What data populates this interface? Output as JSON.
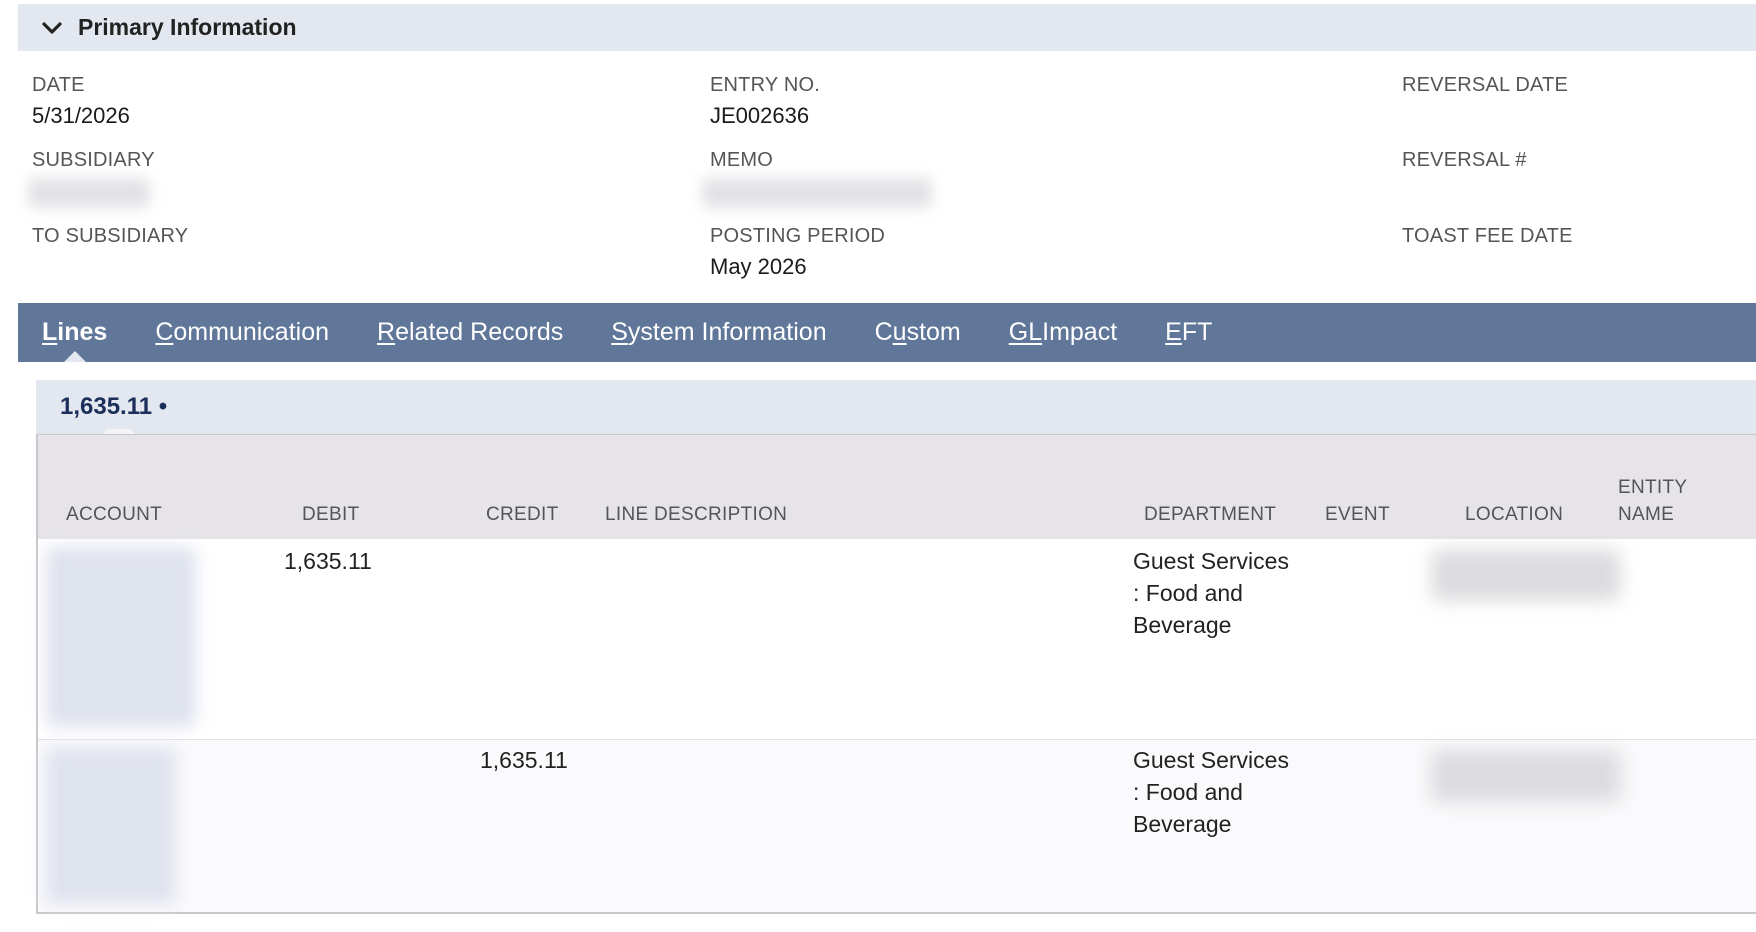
{
  "primary": {
    "title": "Primary Information",
    "fields": {
      "date_label": "DATE",
      "date_value": "5/31/2026",
      "entry_label": "ENTRY NO.",
      "entry_value": "JE002636",
      "reversal_date_label": "REVERSAL DATE",
      "subsidiary_label": "SUBSIDIARY",
      "memo_label": "MEMO",
      "reversal_num_label": "REVERSAL #",
      "to_subsidiary_label": "TO SUBSIDIARY",
      "posting_period_label": "POSTING PERIOD",
      "posting_period_value": "May 2026",
      "toast_fee_date_label": "TOAST FEE DATE"
    }
  },
  "tabs": [
    {
      "first": "L",
      "rest": "ines"
    },
    {
      "first": "C",
      "rest": "ommunication"
    },
    {
      "first": "R",
      "rest": "elated Records"
    },
    {
      "first": "S",
      "rest": "ystem Information"
    },
    {
      "pre": "C",
      "first": "u",
      "rest": "stom"
    },
    {
      "first": "GL",
      "rest": " Impact"
    },
    {
      "first": "E",
      "rest": "FT"
    }
  ],
  "subtab": {
    "label": "1,635.11 •"
  },
  "grid": {
    "columns": {
      "account": "ACCOUNT",
      "debit": "DEBIT",
      "credit": "CREDIT",
      "line_description": "LINE DESCRIPTION",
      "department": "DEPARTMENT",
      "event": "EVENT",
      "location": "LOCATION",
      "entity_name_1": "ENTITY",
      "entity_name_2": "NAME"
    },
    "rows": [
      {
        "debit": "1,635.11",
        "credit": "",
        "department": [
          "Guest Services",
          ": Food and",
          "Beverage"
        ]
      },
      {
        "debit": "",
        "credit": "1,635.11",
        "department": [
          "Guest Services",
          ": Food and",
          "Beverage"
        ]
      }
    ]
  },
  "colors": {
    "tabbar": "#607799",
    "section_header": "#e3e7ef",
    "subtab_text": "#1c2f5a"
  }
}
